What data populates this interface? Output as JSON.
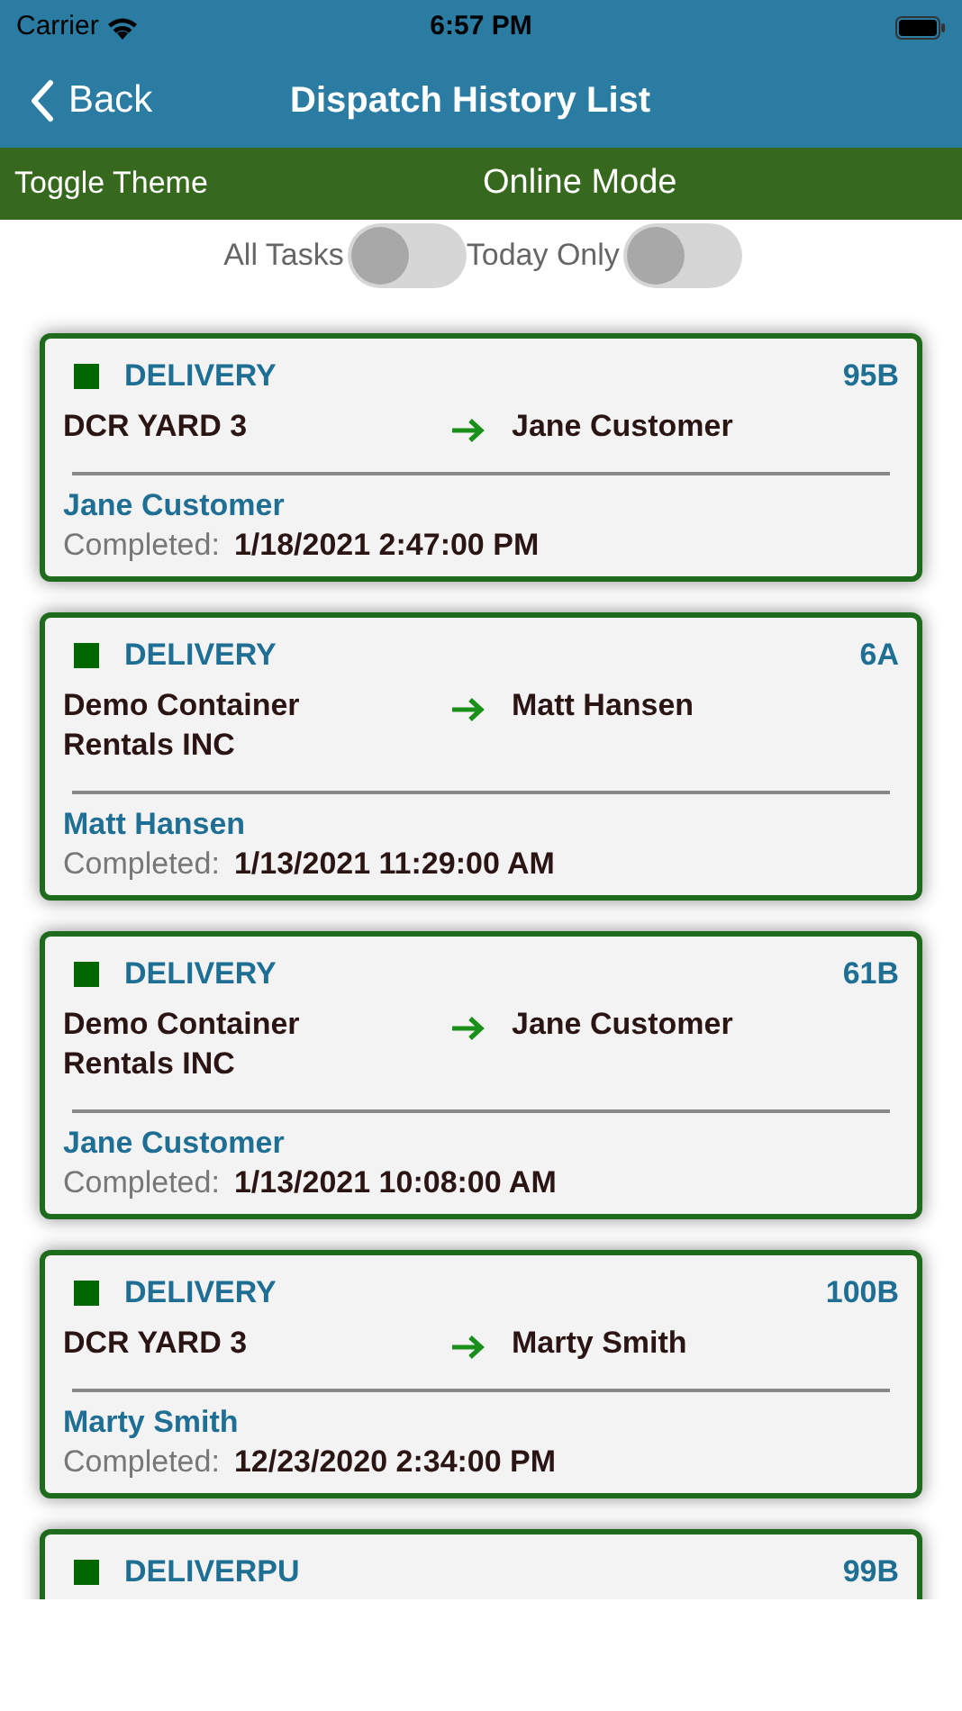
{
  "status_bar": {
    "carrier": "Carrier",
    "time": "6:57 PM"
  },
  "nav": {
    "back": "Back",
    "title": "Dispatch History List"
  },
  "mode_bar": {
    "toggle_theme": "Toggle Theme",
    "mode": "Online Mode"
  },
  "filters": [
    {
      "label": "All Tasks",
      "on": false
    },
    {
      "label": "Today Only",
      "on": false
    }
  ],
  "dispatches": [
    {
      "type": "DELIVERY",
      "color": "#006600",
      "code": "95B",
      "from": "DCR YARD 3",
      "to": "Jane Customer",
      "customer": "Jane Customer",
      "completed_label": "Completed:",
      "completed": "1/18/2021 2:47:00 PM"
    },
    {
      "type": "DELIVERY",
      "color": "#006600",
      "code": "6A",
      "from": "Demo Container Rentals INC",
      "to": "Matt Hansen",
      "customer": "Matt Hansen",
      "completed_label": "Completed:",
      "completed": "1/13/2021 11:29:00 AM"
    },
    {
      "type": "DELIVERY",
      "color": "#006600",
      "code": "61B",
      "from": "Demo Container Rentals INC",
      "to": "Jane Customer",
      "customer": "Jane Customer",
      "completed_label": "Completed:",
      "completed": "1/13/2021 10:08:00 AM"
    },
    {
      "type": "DELIVERY",
      "color": "#006600",
      "code": "100B",
      "from": "DCR YARD 3",
      "to": "Marty Smith",
      "customer": "Marty Smith",
      "completed_label": "Completed:",
      "completed": "12/23/2020 2:34:00 PM"
    },
    {
      "type": "DELIVERPU",
      "color": "#006600",
      "code": "99B"
    }
  ]
}
